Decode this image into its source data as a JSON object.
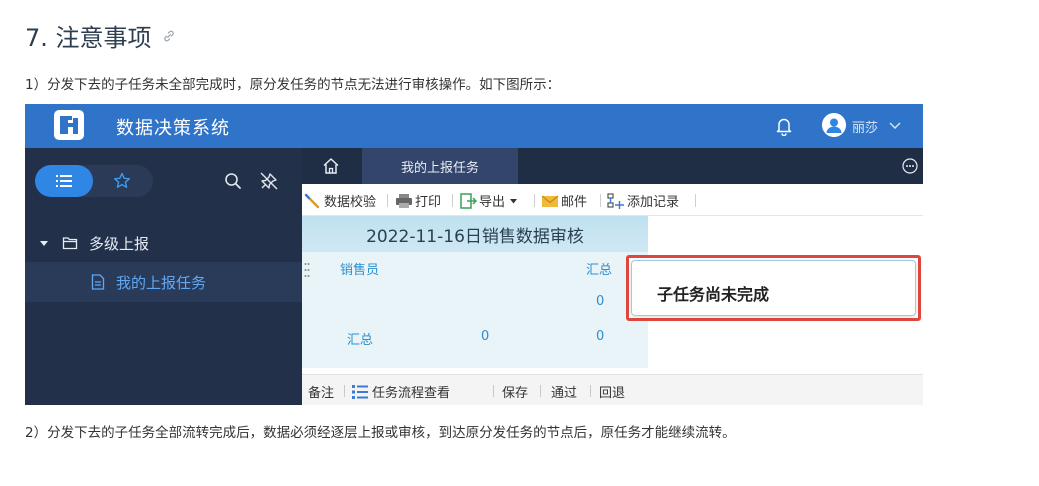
{
  "doc": {
    "heading": "7. 注意事项",
    "para1": "1）分发下去的子任务未全部完成时，原分发任务的节点无法进行审核操作。如下图所示：",
    "para2": "2）分发下去的子任务全部流转完成后，数据必须经逐层上报或审核，到达原分发任务的节点后，原任务才能继续流转。"
  },
  "app": {
    "title": "数据决策系统",
    "user_name": "丽莎",
    "brand_color": "#2f74c9"
  },
  "sidebar": {
    "folder_label": "多级上报",
    "item_label": "我的上报任务"
  },
  "tabs": {
    "report_tab_label": "我的上报任务"
  },
  "toolbar": {
    "items": [
      "数据校验",
      "打印",
      "导出",
      "邮件",
      "添加记录"
    ]
  },
  "report": {
    "title": "2022-11-16日销售数据审核",
    "header_salesperson": "销售员",
    "header_total": "汇总",
    "row1_total": "0",
    "summary_label": "汇总",
    "summary_value1": "0",
    "summary_value2": "0"
  },
  "popup": {
    "message": "子任务尚未完成"
  },
  "bottombar": {
    "items": [
      "备注",
      "任务流程查看",
      "保存",
      "通过",
      "回退"
    ]
  }
}
